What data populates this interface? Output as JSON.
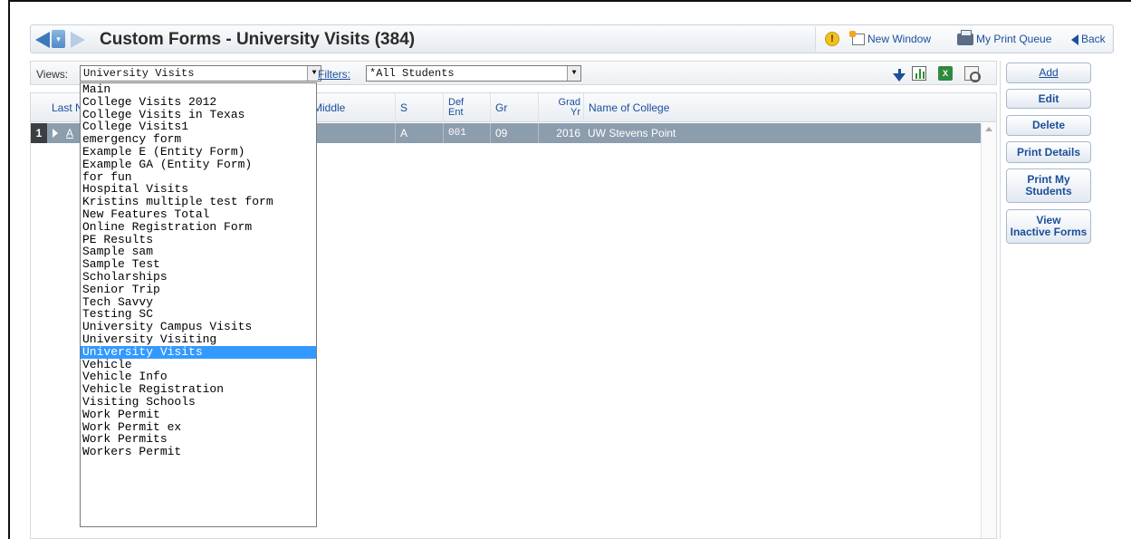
{
  "header": {
    "title": "Custom Forms - University Visits (384)",
    "new_window": "New Window",
    "print_queue": "My Print Queue",
    "back": "Back"
  },
  "views_bar": {
    "views_label": "Views:",
    "views_value": "University Visits",
    "filters_label": "Filters:",
    "filters_value": "*All Students"
  },
  "grid": {
    "columns": {
      "last": "Last N",
      "middle": "Middle",
      "s": "S",
      "def_ent_1": "Def",
      "def_ent_2": "Ent",
      "gr": "Gr",
      "grad_yr_1": "Grad",
      "grad_yr_2": "Yr",
      "college": "Name of College"
    },
    "row": {
      "num": "1",
      "last": "A",
      "s": "A",
      "def_ent": "001",
      "gr": "09",
      "grad_yr": "2016",
      "college": "UW Stevens Point"
    }
  },
  "buttons": {
    "add": "Add",
    "edit": "Edit",
    "delete": "Delete",
    "print_details": "Print Details",
    "print_my_1": "Print My",
    "print_my_2": "Students",
    "view_inactive_1": "View",
    "view_inactive_2": "Inactive Forms"
  },
  "dropdown": {
    "items": [
      "Main",
      "College Visits 2012",
      "College Visits in Texas",
      "College Visits1",
      "emergency form",
      "Example E (Entity Form)",
      "Example GA (Entity Form)",
      "for fun",
      "Hospital Visits",
      "Kristins multiple test form",
      "New Features Total",
      "Online Registration Form",
      "PE Results",
      "Sample sam",
      "Sample Test",
      "Scholarships",
      "Senior Trip",
      "Tech Savvy",
      "Testing SC",
      "University Campus Visits",
      "University Visiting",
      "University Visits",
      "Vehicle",
      "Vehicle Info",
      "Vehicle Registration",
      "Visiting Schools",
      "Work Permit",
      "Work Permit ex",
      "Work Permits",
      "Workers Permit"
    ],
    "selected": "University Visits"
  },
  "colors": {
    "accent": "#1b4e9b",
    "selected_row": "#8c9dad",
    "selected_item": "#3399ff"
  }
}
